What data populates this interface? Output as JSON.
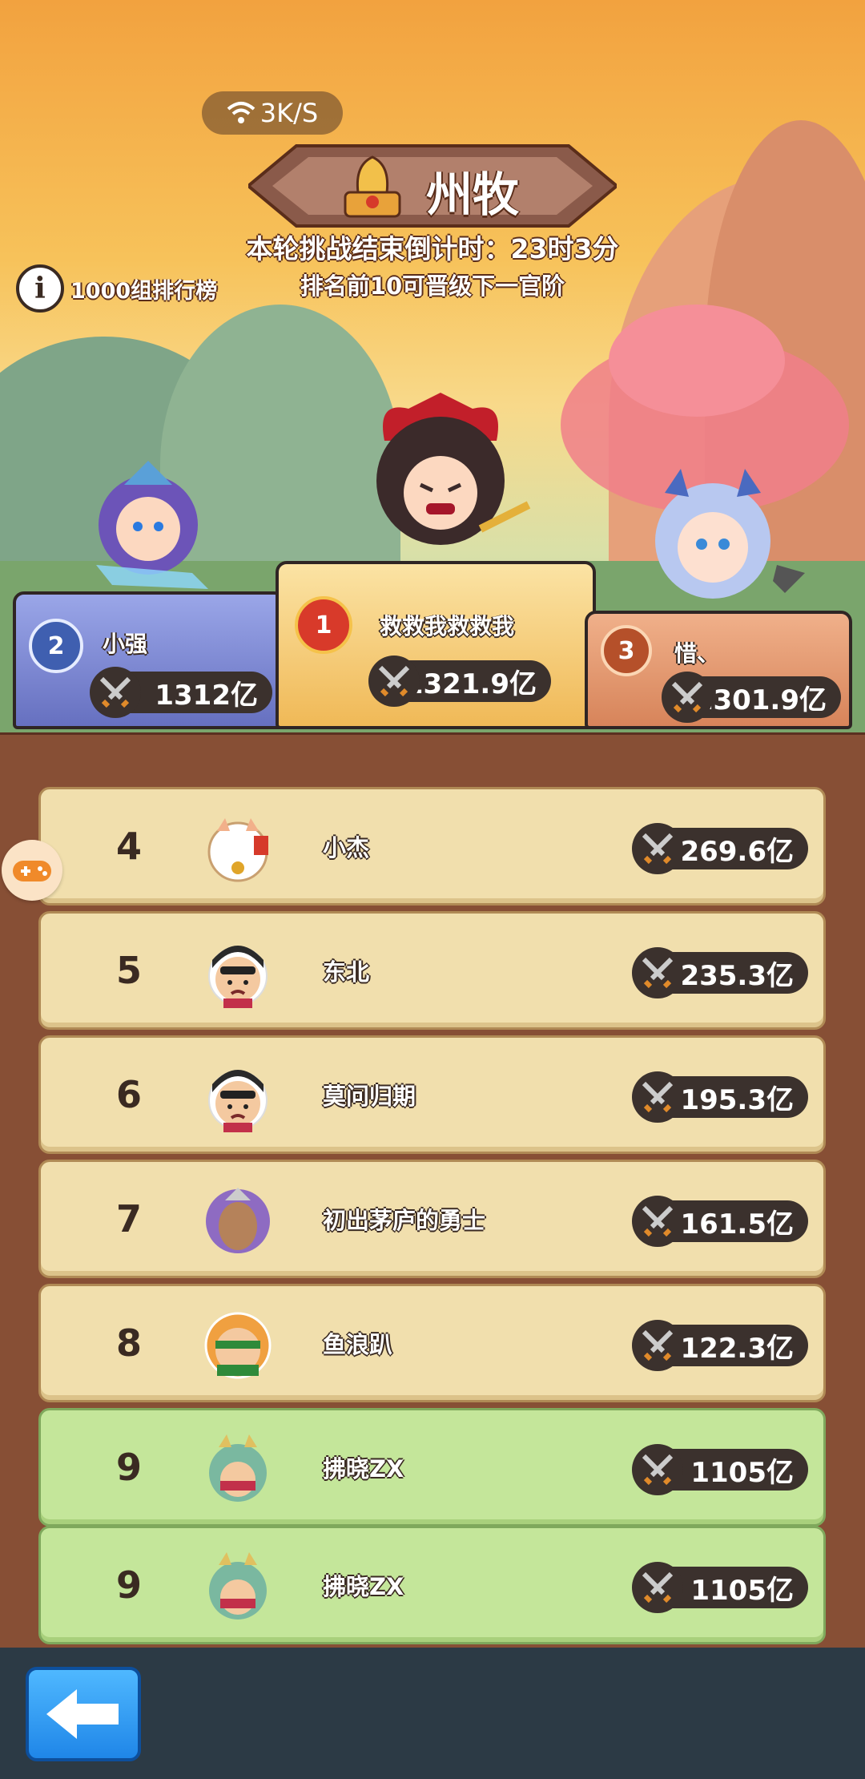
{
  "status_bar": {
    "network_speed": "3K/S"
  },
  "header": {
    "title": "州牧",
    "countdown": "本轮挑战结束倒计时：23时3分",
    "promotion_note": "排名前10可晋级下一官阶"
  },
  "info": {
    "label": "1000组排行榜"
  },
  "podium": [
    {
      "rank": "1",
      "name": "救救我救救我",
      "power": "1321.9亿"
    },
    {
      "rank": "2",
      "name": "小强",
      "power": "1312亿"
    },
    {
      "rank": "3",
      "name": "惜、",
      "power": "1301.9亿"
    }
  ],
  "leaderboard": [
    {
      "rank": "4",
      "name": "小杰",
      "power": "1269.6亿",
      "avatar": "lucky-cat-icon",
      "highlight": false
    },
    {
      "rank": "5",
      "name": "东北",
      "power": "1235.3亿",
      "avatar": "man-avatar-icon",
      "highlight": false
    },
    {
      "rank": "6",
      "name": "莫问归期",
      "power": "1195.3亿",
      "avatar": "man-avatar-icon",
      "highlight": false
    },
    {
      "rank": "7",
      "name": "初出茅庐的勇士",
      "power": "1161.5亿",
      "avatar": "horse-avatar-icon",
      "highlight": false
    },
    {
      "rank": "8",
      "name": "鱼浪趴",
      "power": "1122.3亿",
      "avatar": "headband-avatar-icon",
      "highlight": false
    },
    {
      "rank": "9",
      "name": "拂晓ZX",
      "power": "1105亿",
      "avatar": "dragon-avatar-icon",
      "highlight": true
    },
    {
      "rank": "9",
      "name": "拂晓ZX",
      "power": "1105亿",
      "avatar": "dragon-avatar-icon",
      "highlight": true
    }
  ],
  "colors": {
    "row_default": "#f1dfad",
    "row_self": "#c4e69a",
    "board": "#874f35",
    "back_button": "#2b95f0"
  }
}
